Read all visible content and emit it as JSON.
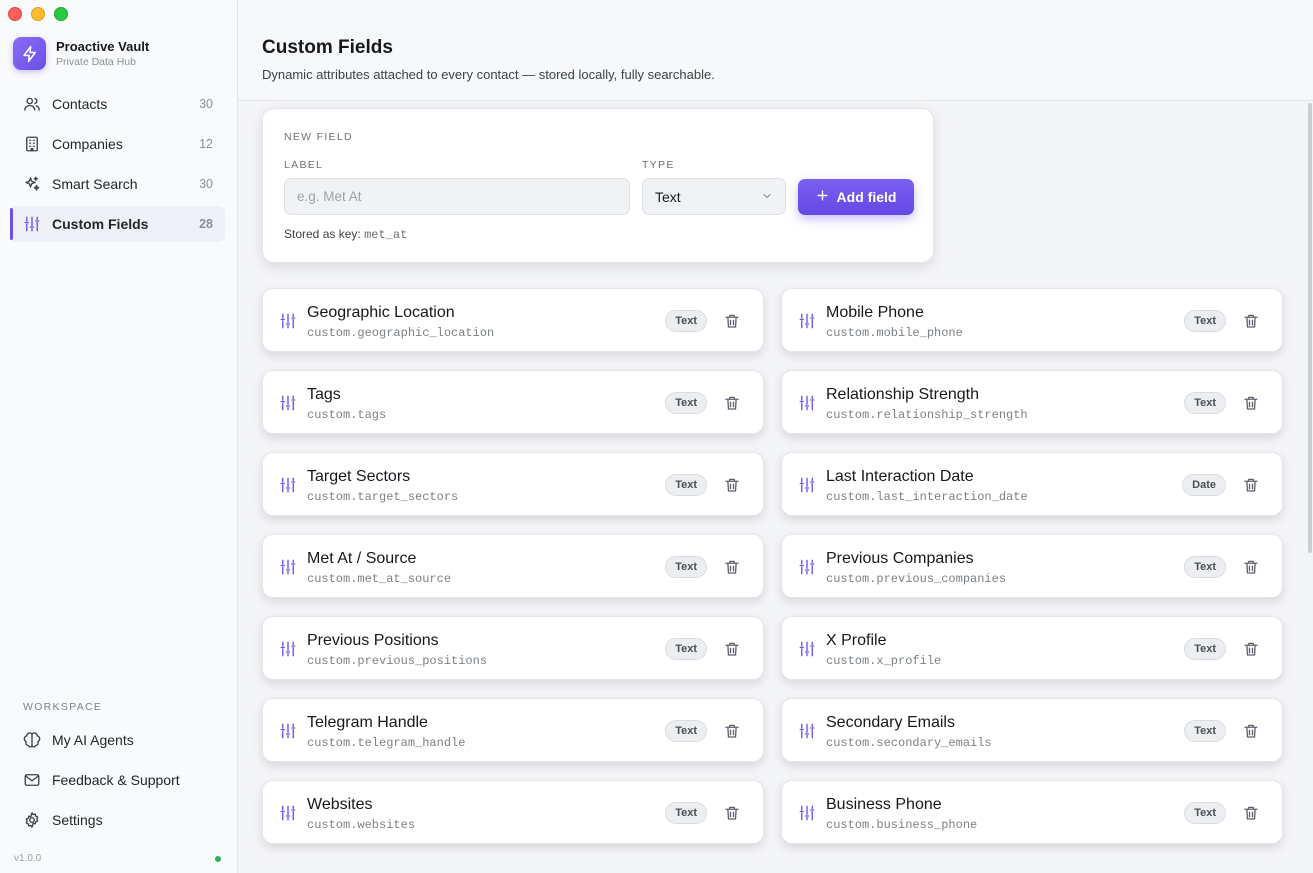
{
  "window": {
    "traffic_lights": [
      "close",
      "minimize",
      "zoom"
    ]
  },
  "brand": {
    "title": "Proactive Vault",
    "subtitle": "Private Data Hub",
    "icon": "bolt-icon",
    "accent": "#6d52ea"
  },
  "nav": [
    {
      "label": "Contacts",
      "count": "30",
      "icon": "users-icon"
    },
    {
      "label": "Companies",
      "count": "12",
      "icon": "building-icon"
    },
    {
      "label": "Smart Search",
      "count": "30",
      "icon": "sparkles-icon"
    },
    {
      "label": "Custom Fields",
      "count": "28",
      "icon": "sliders-icon",
      "active": true
    }
  ],
  "workspace": {
    "label": "WORKSPACE",
    "items": [
      {
        "label": "My AI Agents",
        "icon": "brain-icon"
      },
      {
        "label": "Feedback & Support",
        "icon": "mail-icon"
      },
      {
        "label": "Settings",
        "icon": "gear-icon"
      }
    ]
  },
  "footer": {
    "version": "v1.0.0",
    "status_color": "#22b45a"
  },
  "header": {
    "title": "Custom Fields",
    "subtitle": "Dynamic attributes attached to every contact — stored locally, fully searchable."
  },
  "new_field": {
    "section_title": "NEW FIELD",
    "label_label": "LABEL",
    "label_placeholder": "e.g. Met At",
    "label_value": "",
    "type_label": "TYPE",
    "type_value": "Text",
    "add_button": "Add field",
    "stored_prefix": "Stored as key:",
    "stored_key": "met_at"
  },
  "fields": [
    {
      "name": "Geographic Location",
      "key": "custom.geographic_location",
      "type": "Text"
    },
    {
      "name": "Mobile Phone",
      "key": "custom.mobile_phone",
      "type": "Text"
    },
    {
      "name": "Tags",
      "key": "custom.tags",
      "type": "Text"
    },
    {
      "name": "Relationship Strength",
      "key": "custom.relationship_strength",
      "type": "Text"
    },
    {
      "name": "Target Sectors",
      "key": "custom.target_sectors",
      "type": "Text"
    },
    {
      "name": "Last Interaction Date",
      "key": "custom.last_interaction_date",
      "type": "Date"
    },
    {
      "name": "Met At / Source",
      "key": "custom.met_at_source",
      "type": "Text"
    },
    {
      "name": "Previous Companies",
      "key": "custom.previous_companies",
      "type": "Text"
    },
    {
      "name": "Previous Positions",
      "key": "custom.previous_positions",
      "type": "Text"
    },
    {
      "name": "X Profile",
      "key": "custom.x_profile",
      "type": "Text"
    },
    {
      "name": "Telegram Handle",
      "key": "custom.telegram_handle",
      "type": "Text"
    },
    {
      "name": "Secondary Emails",
      "key": "custom.secondary_emails",
      "type": "Text"
    },
    {
      "name": "Websites",
      "key": "custom.websites",
      "type": "Text"
    },
    {
      "name": "Business Phone",
      "key": "custom.business_phone",
      "type": "Text"
    }
  ]
}
